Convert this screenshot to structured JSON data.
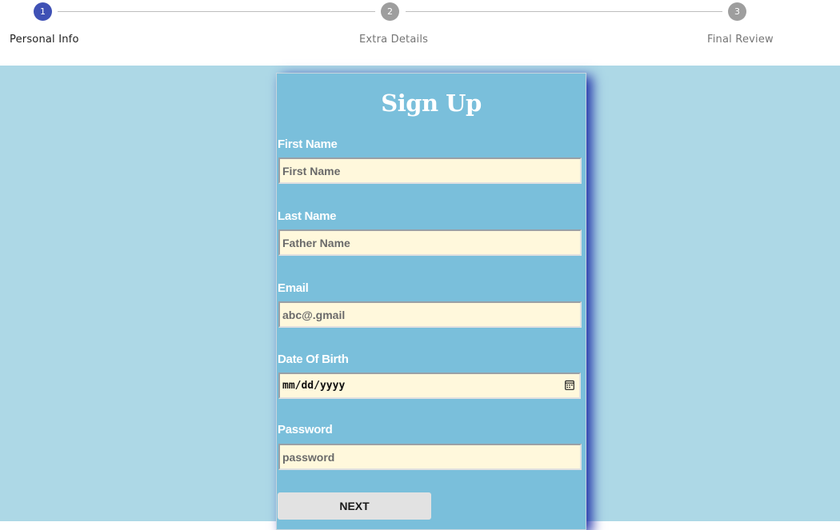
{
  "stepper": {
    "steps": [
      {
        "number": "1",
        "label": "Personal Info",
        "active": true
      },
      {
        "number": "2",
        "label": "Extra Details",
        "active": false
      },
      {
        "number": "3",
        "label": "Final Review",
        "active": false
      }
    ],
    "colors": {
      "active": "#3f51b5",
      "inactive": "#9e9e9e",
      "active_label": "#212121",
      "inactive_label": "#757575"
    }
  },
  "form": {
    "title": "Sign Up",
    "fields": [
      {
        "label": "First Name",
        "placeholder": "First Name",
        "value": ""
      },
      {
        "label": "Last Name",
        "placeholder": "Father Name",
        "value": ""
      },
      {
        "label": "Email",
        "placeholder": "abc@.gmail",
        "value": ""
      },
      {
        "label": "Date Of Birth",
        "placeholder": "mm/dd/yyyy",
        "value": ""
      },
      {
        "label": "Password",
        "placeholder": "password",
        "value": ""
      }
    ],
    "next_label": "NEXT",
    "icons": {
      "date_picker": "calendar-icon"
    }
  },
  "colors": {
    "page_background": "#add8e6",
    "card_background": "#7abfdb",
    "input_background": "#fff8dc",
    "card_shadow": "#1f2fa8"
  }
}
